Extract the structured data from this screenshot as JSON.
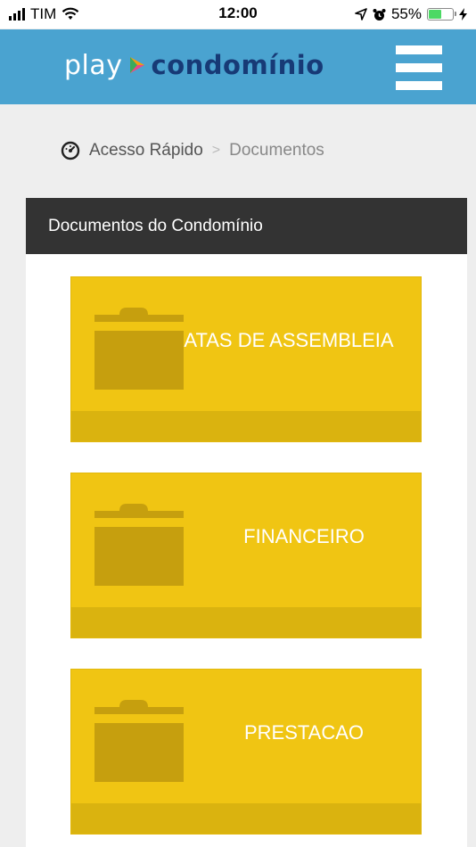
{
  "status_bar": {
    "carrier": "TIM",
    "time": "12:00",
    "battery_percent": "55%",
    "battery_level": 0.55
  },
  "header": {
    "logo_play": "play",
    "logo_condominio": "condomínio",
    "menu_icon": "hamburger-menu-icon"
  },
  "breadcrumb": {
    "home": "Acesso Rápido",
    "separator": ">",
    "current": "Documentos"
  },
  "panel": {
    "title": "Documentos do Condomínio"
  },
  "folders": [
    {
      "label": "ATAS DE ASSEMBLEIA"
    },
    {
      "label": "FINANCEIRO"
    },
    {
      "label": "PRESTACAO"
    }
  ],
  "colors": {
    "header_bg": "#4aa3d0",
    "card_bg": "#f0c513",
    "card_footer": "#dab30f",
    "folder_icon": "#c69f0e",
    "panel_header": "#333333",
    "logo_dark": "#173a76"
  }
}
